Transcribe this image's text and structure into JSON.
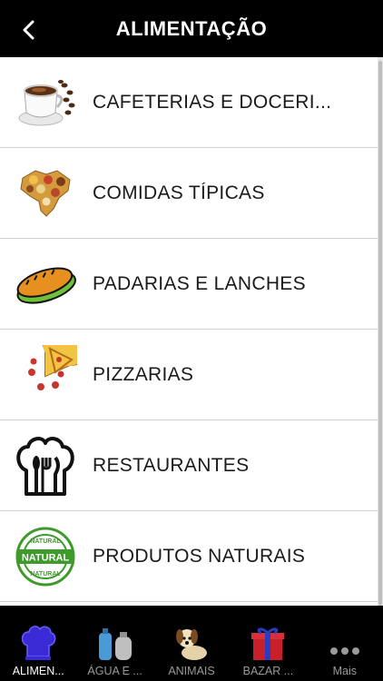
{
  "header": {
    "title": "ALIMENTAÇÃO",
    "back_icon": "chevron-left-icon"
  },
  "categories": [
    {
      "label": "CAFETERIAS E DOCERI...",
      "icon": "coffee-cup-icon"
    },
    {
      "label": "COMIDAS TÍPICAS",
      "icon": "brazil-food-map-icon"
    },
    {
      "label": "PADARIAS E LANCHES",
      "icon": "sandwich-icon"
    },
    {
      "label": "PIZZARIAS",
      "icon": "pizza-icon"
    },
    {
      "label": "RESTAURANTES",
      "icon": "chef-hat-cutlery-icon"
    },
    {
      "label": "PRODUTOS NATURAIS",
      "icon": "natural-stamp-icon",
      "stamp_text": "NATURAL"
    }
  ],
  "tabbar": {
    "tabs": [
      {
        "label": "ALIMEN...",
        "icon": "chef-hat-icon",
        "active": true
      },
      {
        "label": "ÁGUA E ...",
        "icon": "water-gas-icon",
        "active": false
      },
      {
        "label": "ANIMAIS",
        "icon": "dog-icon",
        "active": false
      },
      {
        "label": "BAZAR ...",
        "icon": "gift-icon",
        "active": false
      },
      {
        "label": "Mais",
        "icon": "more-dots-icon",
        "active": false
      }
    ]
  },
  "colors": {
    "bar": "#000000",
    "active_tab_icon": "#3a2bd6",
    "stamp_green": "#3f9a2c"
  }
}
